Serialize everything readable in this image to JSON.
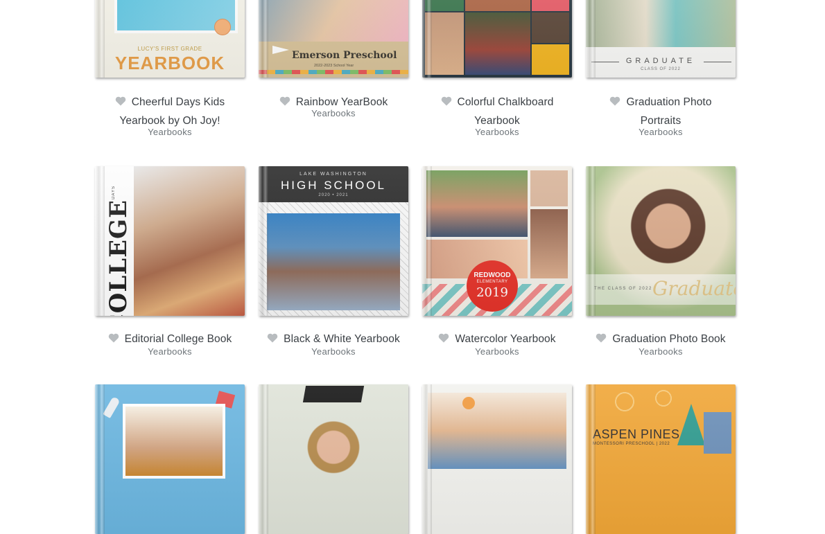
{
  "products": [
    {
      "title_line1": "Cheerful Days Kids",
      "title_line2": "Yearbook by Oh Joy!",
      "category": "Yearbooks",
      "cover_text": [
        "LUCY'S FIRST GRADE",
        "YEARBOOK"
      ]
    },
    {
      "title_line1": "Rainbow YearBook",
      "title_line2": "",
      "category": "Yearbooks",
      "cover_text": [
        "Emerson Preschool",
        "2022-2023 School Year"
      ]
    },
    {
      "title_line1": "Colorful Chalkboard",
      "title_line2": "Yearbook",
      "category": "Yearbooks",
      "cover_text": []
    },
    {
      "title_line1": "Graduation Photo",
      "title_line2": "Portraits",
      "category": "Yearbooks",
      "cover_text": [
        "GRADUATE",
        "CLASS OF 2022"
      ]
    },
    {
      "title_line1": "Editorial College Book",
      "category": "Yearbooks",
      "cover_text": [
        "DAYS",
        "COLLEGE"
      ]
    },
    {
      "title_line1": "Black & White Yearbook",
      "category": "Yearbooks",
      "cover_text": [
        "LAKE WASHINGTON",
        "HIGH SCHOOL",
        "2020 • 2021"
      ]
    },
    {
      "title_line1": "Watercolor Yearbook",
      "category": "Yearbooks",
      "cover_text": [
        "REDWOOD",
        "ELEMENTARY",
        "2019"
      ]
    },
    {
      "title_line1": "Graduation Photo Book",
      "category": "Yearbooks",
      "cover_text": [
        "THE CLASS OF 2022",
        "Graduate"
      ]
    },
    {
      "title_line1": "",
      "category": "",
      "cover_text": []
    },
    {
      "title_line1": "",
      "category": "",
      "cover_text": []
    },
    {
      "title_line1": "",
      "category": "",
      "cover_text": []
    },
    {
      "title_line1": "",
      "category": "",
      "cover_text": [
        "ASPEN PINES",
        "MONTESSORI PRESCHOOL | 2022"
      ]
    }
  ],
  "colors": {
    "heart": "#b8bcbf",
    "title_text": "#3a3f44",
    "category_text": "#6c7378"
  },
  "icons": {
    "favorite": "heart-icon"
  }
}
